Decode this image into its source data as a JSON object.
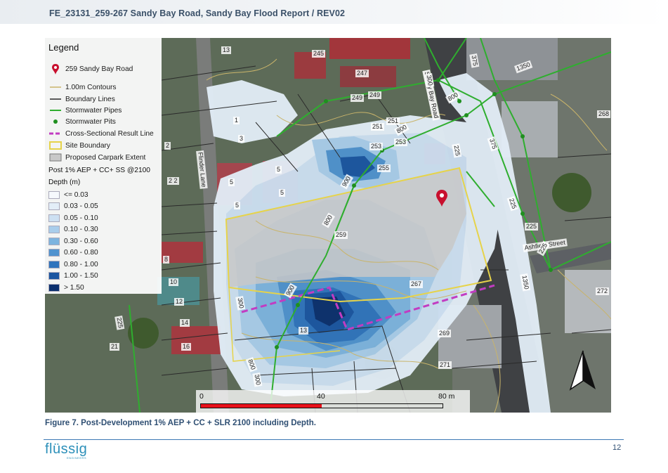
{
  "header": {
    "title": "FE_23131_259-267 Sandy Bay Road, Sandy Bay Flood Report / REV02"
  },
  "legend": {
    "title": "Legend",
    "items": [
      {
        "label": "259 Sandy Bay Road",
        "icon": "map-pin-icon"
      },
      {
        "label": "1.00m Contours"
      },
      {
        "label": "Boundary Lines"
      },
      {
        "label": "Stormwater Pipes"
      },
      {
        "label": "Stormwater Pits"
      },
      {
        "label": "Cross-Sectional Result Line"
      },
      {
        "label": "Site Boundary"
      },
      {
        "label": "Proposed Carpark Extent"
      }
    ],
    "scenario": "Post 1% AEP + CC+ SS @2100",
    "depth_title": "Depth (m)",
    "depth_classes": [
      {
        "label": "<= 0.03",
        "color": "#f6f9fd"
      },
      {
        "label": "0.03 - 0.05",
        "color": "#e3eef8"
      },
      {
        "label": "0.05 - 0.10",
        "color": "#cde0f2"
      },
      {
        "label": "0.10 - 0.30",
        "color": "#a9cdeb"
      },
      {
        "label": "0.30 - 0.60",
        "color": "#7db4df"
      },
      {
        "label": "0.60 - 0.80",
        "color": "#4f93cf"
      },
      {
        "label": "0.80 - 1.00",
        "color": "#2f74bd"
      },
      {
        "label": "1.00 - 1.50",
        "color": "#1a55a1"
      },
      {
        "label": "> 1.50",
        "color": "#0a2f6e"
      }
    ]
  },
  "colors": {
    "contour": "#c9b46a",
    "boundary": "#2a2a2a",
    "pipe": "#2fae2f",
    "pit": "#1f8f1f",
    "cross_section": "#c23cc2",
    "site_boundary": "#e6d34a",
    "carpark": "#c8c8c8",
    "pin": "#c8102e"
  },
  "scale_bar": {
    "labels": [
      "0",
      "40",
      "80 m"
    ]
  },
  "map_labels": {
    "streets": [
      "Sandy Bay Road",
      "Flinder Lane",
      "Ashfield Street"
    ],
    "lots": [
      "13",
      "245",
      "247",
      "249",
      "249",
      "251",
      "251",
      "253",
      "253",
      "255",
      "259",
      "267",
      "269",
      "271",
      "13",
      "5",
      "5",
      "5",
      "5",
      "1",
      "3",
      "2",
      "2 2",
      "8",
      "10",
      "12",
      "14",
      "16",
      "21",
      "272",
      "268"
    ],
    "pipes": [
      "300",
      "800",
      "225",
      "375",
      "1350",
      "800",
      "900",
      "800",
      "900",
      "300",
      "800",
      "300",
      "375",
      "225",
      "1350",
      "225",
      "225",
      "225"
    ]
  },
  "figure_caption": "Figure 7. Post-Development 1% AEP + CC + SLR 2100 including Depth.",
  "footer": {
    "logo": "flüssig",
    "logo_sub": "ENGINEERS",
    "page": "12"
  }
}
